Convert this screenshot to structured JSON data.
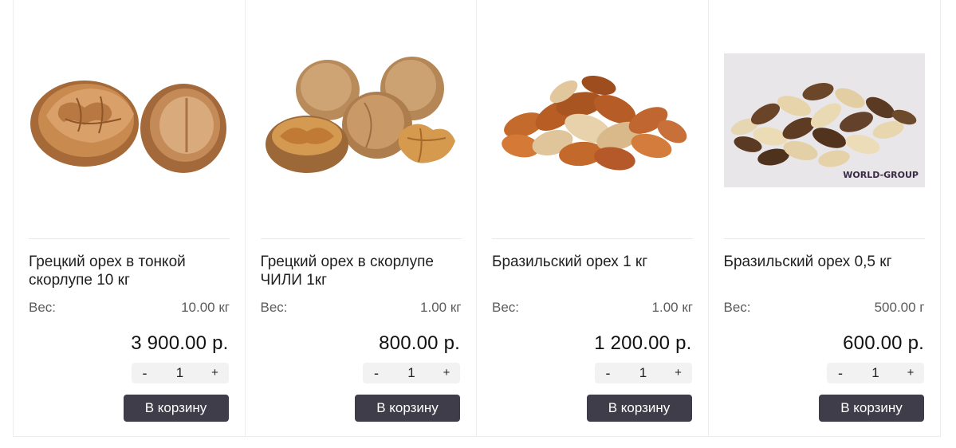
{
  "products": [
    {
      "image": "walnut-thin-shell-image",
      "title": "Грецкий орех в тонкой скорлупе 10 кг",
      "weight_label": "Вес:",
      "weight_value": "10.00 кг",
      "price": "3 900.00 р.",
      "qty_minus": "-",
      "qty_value": "1",
      "qty_plus": "+",
      "cart_label": "В корзину"
    },
    {
      "image": "walnut-chili-image",
      "title": "Грецкий орех в скорлупе ЧИЛИ 1кг",
      "weight_label": "Вес:",
      "weight_value": "1.00 кг",
      "price": "800.00 р.",
      "qty_minus": "-",
      "qty_value": "1",
      "qty_plus": "+",
      "cart_label": "В корзину"
    },
    {
      "image": "brazil-nut-image",
      "title": "Бразильский орех 1 кг",
      "weight_label": "Вес:",
      "weight_value": "1.00 кг",
      "price": "1 200.00 р.",
      "qty_minus": "-",
      "qty_value": "1",
      "qty_plus": "+",
      "cart_label": "В корзину"
    },
    {
      "image": "brazil-nut-half-kg-image",
      "title": "Бразильский орех 0,5 кг",
      "weight_label": "Вес:",
      "weight_value": "500.00 г",
      "price": "600.00 р.",
      "qty_minus": "-",
      "qty_value": "1",
      "qty_plus": "+",
      "cart_label": "В корзину",
      "watermark": "WORLD-GROUP"
    }
  ],
  "colors": {
    "cart_button_bg": "#3e3d49",
    "qty_bg": "#f2f2f2",
    "border": "#ececec"
  }
}
